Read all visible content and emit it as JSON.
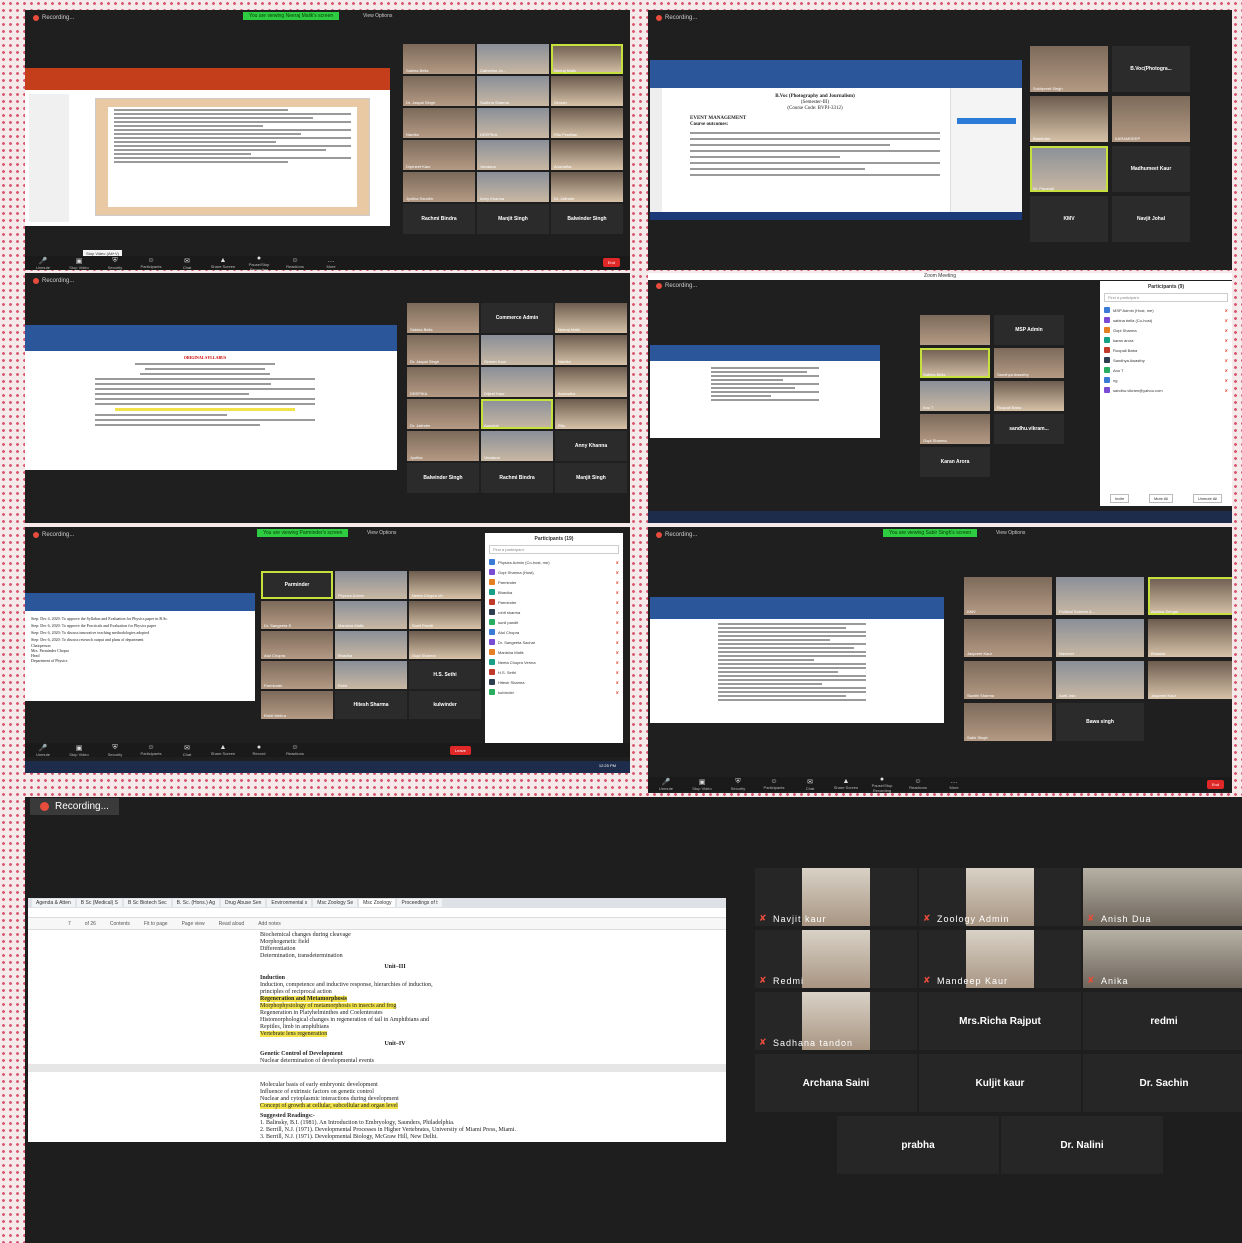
{
  "common": {
    "recording": "Recording...",
    "view_options": "View Options"
  },
  "p1": {
    "banner": "You are viewing Neeraj Malik's screen",
    "tooltip": "Stop Video (Alt+V)",
    "tiles": [
      {
        "name": "Sabina Bella",
        "video": true
      },
      {
        "name": "Catherine Jo...",
        "video": true
      },
      {
        "name": "Neeraj Malik",
        "video": true,
        "active": true
      },
      {
        "name": "Dr. Jaspal Singh",
        "video": true
      },
      {
        "name": "Sadhna Sharma",
        "video": true
      },
      {
        "name": "Simran",
        "video": true
      },
      {
        "name": "Namita",
        "video": true
      },
      {
        "name": "DEEPIKA",
        "video": true
      },
      {
        "name": "Ritu Pradhan",
        "video": true
      },
      {
        "name": "Diprneet Kaur",
        "video": true
      },
      {
        "name": "Vandana",
        "video": true
      },
      {
        "name": "Anuradha",
        "video": true
      },
      {
        "name": "Jyotika Sandhir",
        "video": true
      },
      {
        "name": "Anny Khanna",
        "video": true
      },
      {
        "name": "Dr. Jatinder",
        "video": true
      },
      {
        "name": "Rachmi Bindra",
        "video": false
      },
      {
        "name": "Manjit Singh",
        "video": false
      },
      {
        "name": "Balwinder Singh",
        "video": false
      }
    ],
    "toolbar": [
      "Unmute",
      "Stop Video",
      "Security",
      "Participants",
      "Chat",
      "Share Screen",
      "Pause/Stop Recording",
      "Reactions",
      "More"
    ],
    "end": "End"
  },
  "p2": {
    "doc_title": "B.Voc (Photography and Journalism)",
    "doc_sub": "(Semester-III)",
    "doc_code": "(Course Code: BVPJ-3312)",
    "doc_head": "EVENT MANAGEMENT",
    "doc_head2": "Course outcomes:",
    "tiles": [
      {
        "name": "Sukhpreet Singh",
        "video": true
      },
      {
        "name": "B.Voc(Photogra...",
        "video": false
      },
      {
        "name": "Balwinder",
        "video": true
      },
      {
        "name": "KARAMDEEP",
        "video": true
      },
      {
        "name": "Dr. Paramjit",
        "video": true,
        "active": true
      },
      {
        "name": "Madhumeet Kaur",
        "video": false
      },
      {
        "name": "KMV",
        "video": false
      },
      {
        "name": "Navjit Johal",
        "video": false
      }
    ]
  },
  "p3": {
    "doc_title": "ORIGINAL SYLLABUS",
    "tiles": [
      {
        "name": "Sabina Bella",
        "video": true
      },
      {
        "name": "Commerce Admin",
        "video": false
      },
      {
        "name": "Neeraj Malik",
        "video": true
      },
      {
        "name": "Dr. Jaspal Singh",
        "video": true
      },
      {
        "name": "Simran Kaur",
        "video": true
      },
      {
        "name": "Namita",
        "video": true
      },
      {
        "name": "DEEPIKA",
        "video": true
      },
      {
        "name": "Diljeet Kaur",
        "video": true
      },
      {
        "name": "Anuradha",
        "video": true
      },
      {
        "name": "Dr. Jatinder",
        "video": true
      },
      {
        "name": "Aanchal",
        "video": true,
        "active": true
      },
      {
        "name": "Ritu",
        "video": true
      },
      {
        "name": "Jyotika",
        "video": true
      },
      {
        "name": "Vandana",
        "video": true
      },
      {
        "name": "Anny Khanna",
        "video": false
      },
      {
        "name": "Balwinder Singh",
        "video": false
      },
      {
        "name": "Rachmi Bindra",
        "video": false
      },
      {
        "name": "Manjit Singh",
        "video": false
      }
    ]
  },
  "p4": {
    "title": "Zoom Meeting",
    "participants_title": "Participants (9)",
    "find": "Find a participant",
    "participants": [
      "MSP Admin (Host, me)",
      "sabina bella (Co-host)",
      "Gopi Sharma",
      "karan arora",
      "Roopali Batra",
      "Sandhya Awasthy",
      "Anu T",
      "ng",
      "sandhu.vikram@yahoo.com"
    ],
    "buttons": [
      "Invite",
      "Mute All",
      "Unmute All"
    ],
    "tiles": [
      {
        "name": "",
        "video": true
      },
      {
        "name": "MSP Admin",
        "video": false
      },
      {
        "name": "Sabina Bella",
        "video": true,
        "active": true
      },
      {
        "name": "Sandhya Awasthy",
        "video": true
      },
      {
        "name": "Anu T",
        "video": true
      },
      {
        "name": "Roopali Batra",
        "video": true
      },
      {
        "name": "Gopi Sharma",
        "video": true
      },
      {
        "name": "sandhu.vikram...",
        "video": false
      },
      {
        "name": "Karan Arora",
        "video": false
      }
    ]
  },
  "p5": {
    "banner": "You are viewing Parminder's screen",
    "participants_title": "Participants (19)",
    "find": "Find a participant",
    "participants": [
      "Physics Admin (Co-host, me)",
      "Gopi Sharma (Host)",
      "Parminder",
      "Bhavika",
      "Parminder",
      "rohit sharma",
      "sunil pandit",
      "Atul Chopra",
      "Dr. Sangeeta Sachar",
      "Manisha Malik",
      "Neeta Chopra Verma",
      "H.S. Sethi",
      "Hitesh Sharma",
      "kulvinder"
    ],
    "buttons": [
      "Invite",
      "Mute All",
      "Unmute All"
    ],
    "doc_lines": [
      "Step: Dec 4, 2020: To approve the Syllabus and Evaluation for Physics paper in B.Sc.",
      "Step: Dec 6, 2020: To approve the Practicals and Evaluation for Physics paper",
      "Step: Dec 6, 2020: To discuss innovative teaching methodologies adopted",
      "Step: Dec 6, 2020: To discuss research output and plans of department",
      "Chairperson",
      "Mrs. Parminder Chopra",
      "Head",
      "Department of Physics"
    ],
    "tiles": [
      {
        "name": "Parminder",
        "video": false,
        "active": true
      },
      {
        "name": "Physics Admin",
        "video": true
      },
      {
        "name": "Neeta Chopra Ve",
        "video": true
      },
      {
        "name": "Dr. Sangeeta S",
        "video": true
      },
      {
        "name": "Manisha Malik",
        "video": true
      },
      {
        "name": "Sunil Pandit",
        "video": true
      },
      {
        "name": "Atul Chopra",
        "video": true
      },
      {
        "name": "Bhavika",
        "video": true
      },
      {
        "name": "Gopi Sharma",
        "video": true
      },
      {
        "name": "Parminder",
        "video": true
      },
      {
        "name": "Rohit",
        "video": true
      },
      {
        "name": "H.S. Sethi",
        "video": false
      },
      {
        "name": "Rohit Mehra",
        "video": true
      },
      {
        "name": "Hitesh Sharma",
        "video": false
      },
      {
        "name": "kulwinder",
        "video": false
      }
    ],
    "toolbar": [
      "Unmute",
      "Stop Video",
      "Security",
      "Participants",
      "Chat",
      "Share Screen",
      "Record",
      "Reactions"
    ],
    "leave": "Leave",
    "clock": "12:25 PM"
  },
  "p6": {
    "banner": "You are viewing Sabir Singh's screen",
    "tiles": [
      {
        "name": "KMV",
        "video": true
      },
      {
        "name": "Political Science A...",
        "video": true
      },
      {
        "name": "Ashima Sehgal",
        "video": true,
        "active": true
      },
      {
        "name": "Jaspreet Kaur",
        "video": true
      },
      {
        "name": "Navneet",
        "video": true
      },
      {
        "name": "Bhaskar",
        "video": true
      },
      {
        "name": "Swathi Sharma",
        "video": true
      },
      {
        "name": "Aarti Jain",
        "video": true
      },
      {
        "name": "Jaspreet Kaur",
        "video": true
      },
      {
        "name": "Sabir Singh",
        "video": true
      },
      {
        "name": "Bawa singh",
        "video": false
      }
    ],
    "toolbar": [
      "Unmute",
      "Stop Video",
      "Security",
      "Participants",
      "Chat",
      "Share Screen",
      "Pause/Stop Recording",
      "Reactions",
      "More"
    ],
    "end": "End"
  },
  "p7": {
    "recording": "Recording...",
    "browser_tabs": [
      "Agenda & Atten",
      "B Sc (Medical) S",
      "B Sc Biotech Sec",
      "B. Sc. (Hons.) Ag",
      "Drug Abuse Sen",
      "Environmental s",
      "Msc Zoology Se",
      "Msc Zoology",
      "Proceedings of t"
    ],
    "pdf_toolbar": [
      "Contents",
      "Fit to page",
      "Page view",
      "Read aloud",
      "Add notes"
    ],
    "page_lines_a": [
      "Biochemical changes during cleavage",
      "Morphogenetic field",
      "Differentiation",
      "Determination, transdetermination"
    ],
    "unit3": "Unit–III",
    "induction": "Induction",
    "page_lines_b": [
      "Induction, competence and inductive response, hierarchies of induction,",
      "principles of reciprocal action"
    ],
    "hl_b": [
      "Regeneration and Metamorphosis",
      "Morphophysiology of metamorphosis in insects and frog"
    ],
    "page_lines_c": [
      "Regeneration in Platyhelminthes and Coelenterates",
      "Histomorphological changes in regeneration of tail in Amphibians and",
      "Reptiles, limb in amphibians"
    ],
    "hl_c": "Vertebrate lens regeneration",
    "unit4": "Unit–IV",
    "genetic": "Genetic Control of Development",
    "genetic_line": "Nuclear determination of developmental events",
    "page2_lines": [
      "Molecular basis of early embryonic development",
      "Influence of extrinsic factors on genetic control",
      "Nuclear and cytoplasmic interactions during development"
    ],
    "hl_d": "Concept of growth at cellular, subcellular and organ level",
    "readings": "Suggested Readings:-",
    "refs": [
      "1.    Balinsky, B.I. (1981). An Introduction to Embryology, Saunders, Philadelphia.",
      "2.    Berrill, N.J. (1971). Developmental Processes in Higher Vertebrates, University of Miami Press, Miami.",
      "3.    Berrill, N.J. (1971). Developmental Biology, McGraw Hill, New Delhi."
    ],
    "page_of": "of 26",
    "page_num": "7",
    "tiles": [
      {
        "name": "Navjit kaur",
        "video": true
      },
      {
        "name": "Zoology Admin",
        "video": true
      },
      {
        "name": "Anish Dua",
        "video": true,
        "active": true,
        "wide": true
      },
      {
        "name": "Redmi",
        "video": true
      },
      {
        "name": "Mandeep Kaur",
        "video": true
      },
      {
        "name": "Anika",
        "video": true,
        "wide": true
      },
      {
        "name": "Sadhana tandon",
        "video": true
      },
      {
        "name": "Mrs.Richa Rajput",
        "video": false
      },
      {
        "name": "redmi",
        "video": false
      },
      {
        "name": "Archana Saini",
        "video": false
      },
      {
        "name": "Kuljit kaur",
        "video": false
      },
      {
        "name": "Dr. Sachin",
        "video": false
      },
      {
        "name": "prabha",
        "video": false
      },
      {
        "name": "Dr. Nalini",
        "video": false
      }
    ]
  }
}
